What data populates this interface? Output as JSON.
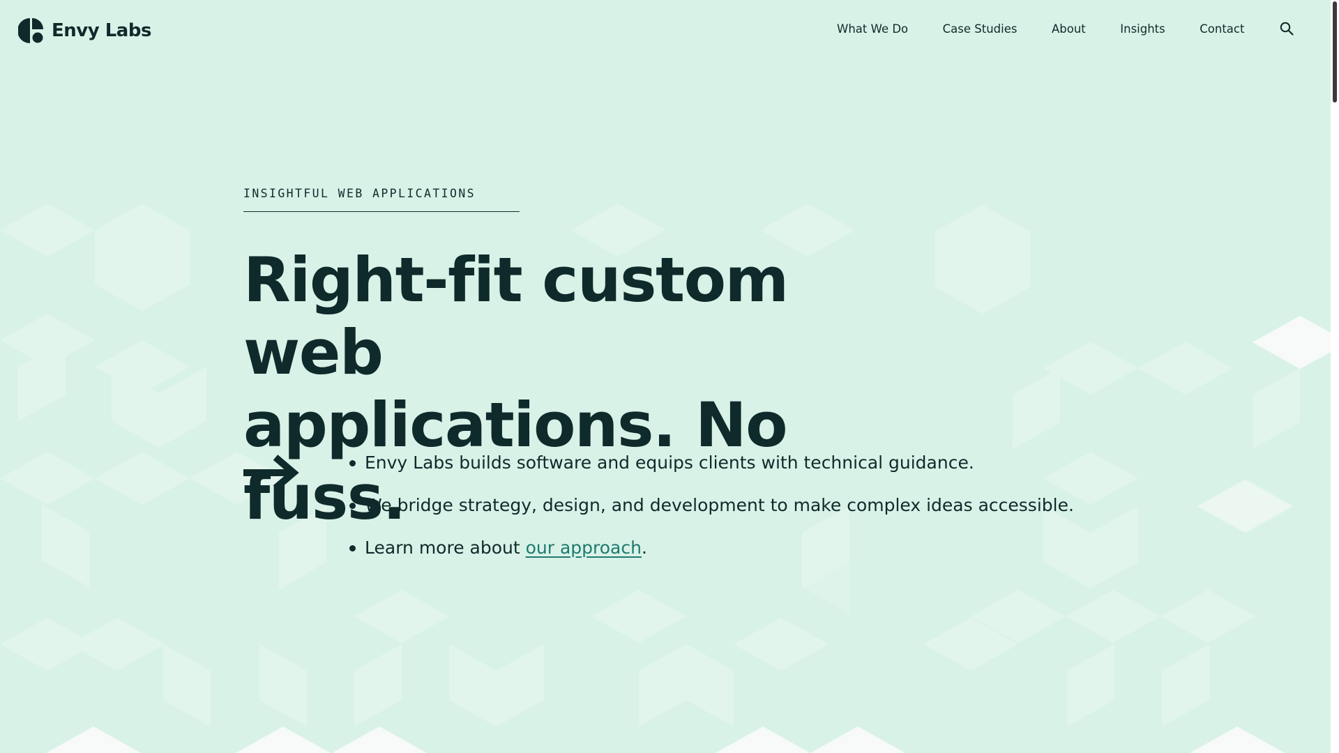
{
  "brand": {
    "name": "Envy Labs",
    "logo_icon": "envy-labs-logo-mark"
  },
  "nav": {
    "items": [
      {
        "label": "What We Do"
      },
      {
        "label": "Case Studies"
      },
      {
        "label": "About"
      },
      {
        "label": "Insights"
      },
      {
        "label": "Contact"
      }
    ],
    "search_icon": "search-icon"
  },
  "hero": {
    "eyebrow": "INSIGHTFUL WEB APPLICATIONS",
    "headline_line1": "Right-fit custom web",
    "headline_line2": "applications. No fuss.",
    "arrow_icon": "arrow-right-icon",
    "points": [
      "Envy Labs builds software and equips clients with technical guidance.",
      "We bridge strategy, design, and development to make complex ideas accessible."
    ],
    "learn_more_prefix": "Learn more about ",
    "learn_more_link": "our approach",
    "learn_more_suffix": "."
  },
  "colors": {
    "background": "#d9f2e8",
    "text": "#0f2a2a",
    "link": "#1f7a6e",
    "cube_face_light": "#e6f6ef",
    "cube_face_white": "#f7faf8"
  }
}
